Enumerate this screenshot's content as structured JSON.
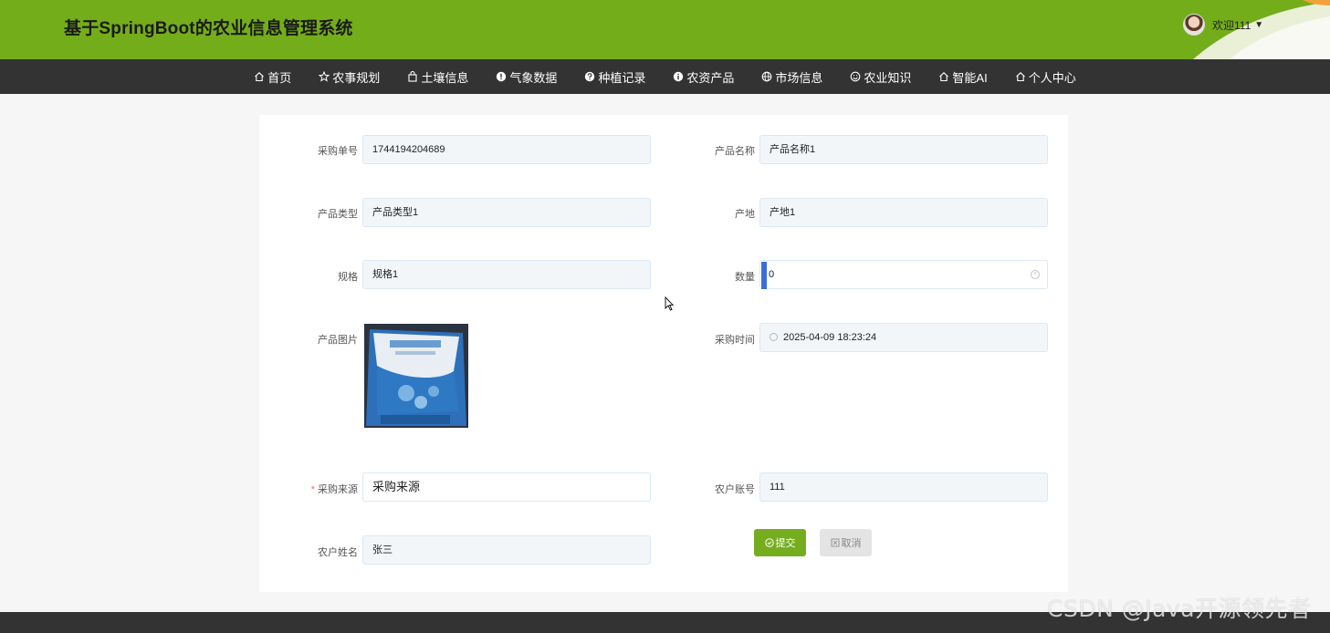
{
  "header": {
    "title": "基于SpringBoot的农业信息管理系统",
    "welcome": "欢迎111",
    "caret": "▼"
  },
  "nav": {
    "items": [
      {
        "label": "首页",
        "icon": "home-icon"
      },
      {
        "label": "农事规划",
        "icon": "star-icon"
      },
      {
        "label": "土壤信息",
        "icon": "bag-icon"
      },
      {
        "label": "气象数据",
        "icon": "info-icon"
      },
      {
        "label": "种植记录",
        "icon": "question-icon"
      },
      {
        "label": "农资产品",
        "icon": "info-icon"
      },
      {
        "label": "市场信息",
        "icon": "globe-icon"
      },
      {
        "label": "农业知识",
        "icon": "smile-icon"
      },
      {
        "label": "智能AI",
        "icon": "home-icon"
      },
      {
        "label": "个人中心",
        "icon": "home-icon"
      }
    ]
  },
  "form": {
    "order_no": {
      "label": "采购单号",
      "value": "1744194204689"
    },
    "product_name": {
      "label": "产品名称",
      "value": "产品名称1"
    },
    "product_type": {
      "label": "产品类型",
      "value": "产品类型1"
    },
    "origin": {
      "label": "产地",
      "value": "产地1"
    },
    "spec": {
      "label": "规格",
      "value": "规格1"
    },
    "quantity": {
      "label": "数量",
      "value": "0"
    },
    "product_image": {
      "label": "产品图片"
    },
    "purchase_time": {
      "label": "采购时间",
      "value": "2025-04-09 18:23:24"
    },
    "source": {
      "label": "采购来源",
      "required_mark": "*",
      "value": "采购来源"
    },
    "farmer_account": {
      "label": "农户账号",
      "value": "111"
    },
    "farmer_name": {
      "label": "农户姓名",
      "value": "张三"
    }
  },
  "buttons": {
    "submit": "提交",
    "cancel": "取消"
  },
  "watermark": "CSDN @Java开源领先者",
  "colors": {
    "header_bg": "#74ad1a",
    "nav_bg": "#333333",
    "submit_bg": "#76ad1f",
    "cancel_bg": "#e4e4e4"
  }
}
